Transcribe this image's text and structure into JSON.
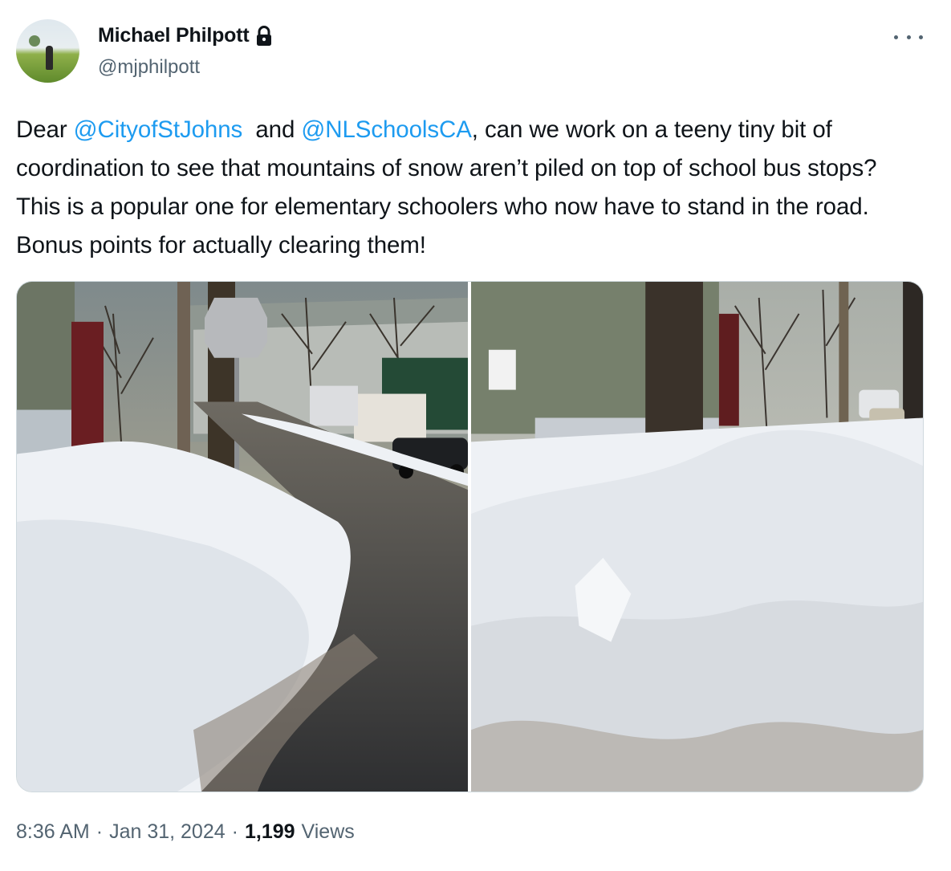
{
  "author": {
    "display_name": "Michael Philpott",
    "handle": "@mjphilpott",
    "protected_icon": "lock-icon",
    "avatar_icon": "avatar-photo"
  },
  "more_icon": "more-horizontal-icon",
  "tweet": {
    "segments": [
      {
        "text": "Dear ",
        "type": "text"
      },
      {
        "text": "@CityofStJohns",
        "type": "mention"
      },
      {
        "text": "  and ",
        "type": "text"
      },
      {
        "text": "@NLSchoolsCA",
        "type": "mention"
      },
      {
        "text": ", can we work on a teeny tiny bit of coordination to see that mountains of snow aren’t piled on top of school bus stops? This is a popular one for elementary schoolers who now have to stand in the road. Bonus points for actually clearing them!",
        "type": "text"
      }
    ]
  },
  "media": {
    "photos": [
      "snowbank-at-bus-stop-street-view",
      "snowbank-at-bus-stop-close-view"
    ]
  },
  "meta": {
    "time": "8:36 AM",
    "separator": "·",
    "date": "Jan 31, 2024",
    "views_count": "1,199",
    "views_label": "Views"
  },
  "colors": {
    "text": "#0f1419",
    "secondary": "#536471",
    "mention": "#1d9bf0",
    "border": "#cfd9de"
  }
}
